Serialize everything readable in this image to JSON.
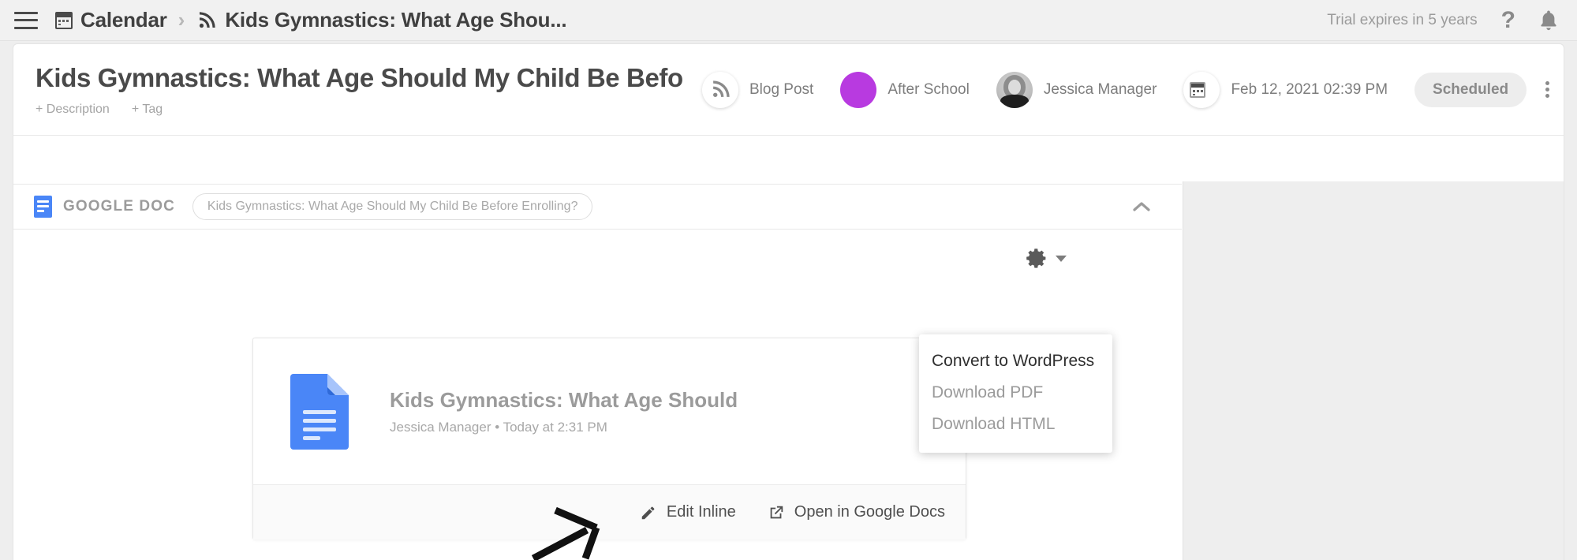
{
  "appbar": {
    "menu_icon": "hamburger-icon",
    "breadcrumb": {
      "root_icon": "calendar-icon",
      "root_label": "Calendar",
      "separator": "›",
      "current_icon": "rss-icon",
      "current_label": "Kids Gymnastics: What Age Shou..."
    },
    "trial_text": "Trial expires in 5 years",
    "help_label": "?",
    "notifications_icon": "bell-icon"
  },
  "post_header": {
    "title": "Kids Gymnastics: What Age Should My Child Be Befo",
    "add_description": "+ Description",
    "add_tag": "+ Tag",
    "type_icon": "rss-icon",
    "type_label": "Blog Post",
    "campaign_color": "#b83ae0",
    "campaign_label": "After School",
    "author_avatar": "user-avatar",
    "author_label": "Jessica Manager",
    "date_icon": "calendar-icon",
    "date_label": "Feb 12, 2021 02:39 PM",
    "status_label": "Scheduled",
    "more_icon": "kebab-menu-icon",
    "close_icon": "close-icon"
  },
  "attachment_bar": {
    "icon": "google-doc-icon",
    "label": "GOOGLE DOC",
    "chip_text": "Kids Gymnastics: What Age Should My Child Be Before Enrolling?",
    "collapse_icon": "chevron-up-icon"
  },
  "toolbar": {
    "settings_icon": "gear-icon",
    "caret_icon": "chevron-down-icon"
  },
  "dropdown": {
    "items": [
      {
        "label": "Convert to WordPress",
        "state": "active"
      },
      {
        "label": "Download PDF",
        "state": "muted"
      },
      {
        "label": "Download HTML",
        "state": "muted"
      }
    ]
  },
  "doc_card": {
    "file_icon": "google-doc-file-icon",
    "name": "Kids Gymnastics: What Age Should",
    "meta": "Jessica Manager • Today at 2:31 PM",
    "actions": [
      {
        "label": "Edit Inline",
        "icon": "pencil-icon"
      },
      {
        "label": "Open in Google Docs",
        "icon": "external-link-icon"
      }
    ]
  },
  "annotation": {
    "arrow": "hand-drawn-arrow pointing to Edit Inline"
  },
  "colors": {
    "accent_purple": "#b83ae0",
    "google_blue": "#4a86f7",
    "app_background": "#eeeeee",
    "panel_background": "#ffffff"
  }
}
